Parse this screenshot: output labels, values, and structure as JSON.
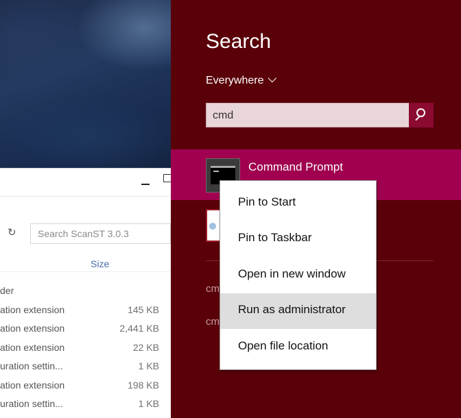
{
  "explorer": {
    "search_placeholder": "Search ScanST 3.0.3",
    "column_size": "Size",
    "rows": [
      {
        "type": "der",
        "size": ""
      },
      {
        "type": "ation extension",
        "size": "145 KB"
      },
      {
        "type": "ation extension",
        "size": "2,441 KB"
      },
      {
        "type": "ation extension",
        "size": "22 KB"
      },
      {
        "type": "uration settin...",
        "size": "1 KB"
      },
      {
        "type": "ation extension",
        "size": "198 KB"
      },
      {
        "type": "uration settin...",
        "size": "1 KB"
      }
    ]
  },
  "charm": {
    "title": "Search",
    "scope": "Everywhere",
    "query": "cmd",
    "result_title": "Command Prompt",
    "suggestions": [
      "cm",
      "cm"
    ]
  },
  "context_menu": {
    "items": [
      "Pin to Start",
      "Pin to Taskbar",
      "Open in new window",
      "Run as administrator",
      "Open file location"
    ],
    "hover_index": 3
  },
  "colors": {
    "charm_bg": "#5a0009",
    "result_highlight": "#a0004f",
    "search_button": "#8a0a30"
  }
}
